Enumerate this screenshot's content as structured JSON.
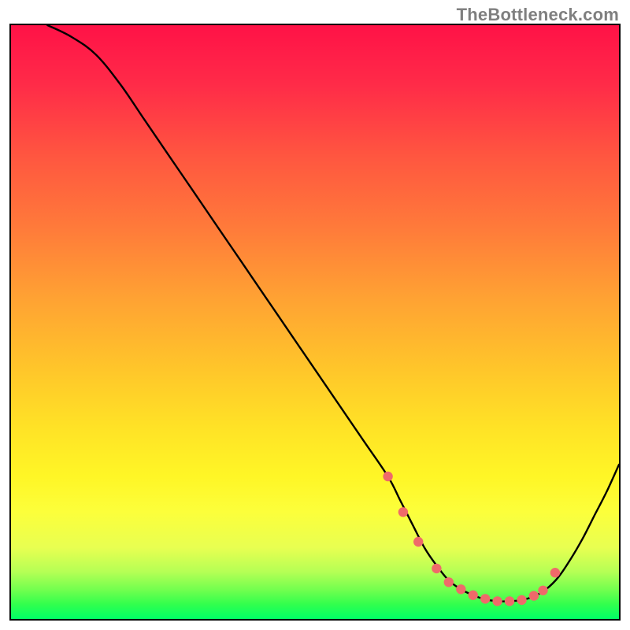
{
  "watermark": "TheBottleneck.com",
  "chart_data": {
    "type": "line",
    "title": "",
    "xlabel": "",
    "ylabel": "",
    "xlim": [
      0,
      100
    ],
    "ylim": [
      0,
      100
    ],
    "grid": false,
    "legend": false,
    "notes": "Single black curve over a red–yellow–green vertical gradient. Y decreases from top (100≈worst/red) to bottom (0≈best/green). A cluster of salmon markers sits in the curve's flat valley around x≈70–86. Axes have no tick labels; values are estimated on a 0–100 scale.",
    "series": [
      {
        "name": "curve",
        "x": [
          6,
          10,
          14,
          18,
          22,
          26,
          30,
          34,
          38,
          42,
          46,
          50,
          54,
          58,
          62,
          64,
          66,
          68,
          70,
          72,
          74,
          76,
          78,
          80,
          82,
          84,
          86,
          88,
          90,
          92,
          94,
          96,
          98,
          100
        ],
        "y": [
          100,
          98,
          95,
          90,
          84,
          78,
          72,
          66,
          60,
          54,
          48,
          42,
          36,
          30,
          24,
          20,
          16,
          12,
          9,
          6.5,
          5,
          4,
          3.3,
          3,
          3,
          3.2,
          3.8,
          5,
          7,
          10,
          13.5,
          17.5,
          21.5,
          26
        ]
      }
    ],
    "markers": {
      "name": "highlight-dots",
      "color": "#ef6a6a",
      "points": [
        {
          "x": 62,
          "y": 24
        },
        {
          "x": 64.5,
          "y": 18
        },
        {
          "x": 67,
          "y": 13
        },
        {
          "x": 70,
          "y": 8.5
        },
        {
          "x": 72,
          "y": 6.2
        },
        {
          "x": 74,
          "y": 5
        },
        {
          "x": 76,
          "y": 4
        },
        {
          "x": 78,
          "y": 3.4
        },
        {
          "x": 80,
          "y": 3
        },
        {
          "x": 82,
          "y": 3
        },
        {
          "x": 84,
          "y": 3.2
        },
        {
          "x": 86,
          "y": 3.9
        },
        {
          "x": 87.5,
          "y": 4.8
        },
        {
          "x": 89.5,
          "y": 7.8
        }
      ]
    }
  }
}
